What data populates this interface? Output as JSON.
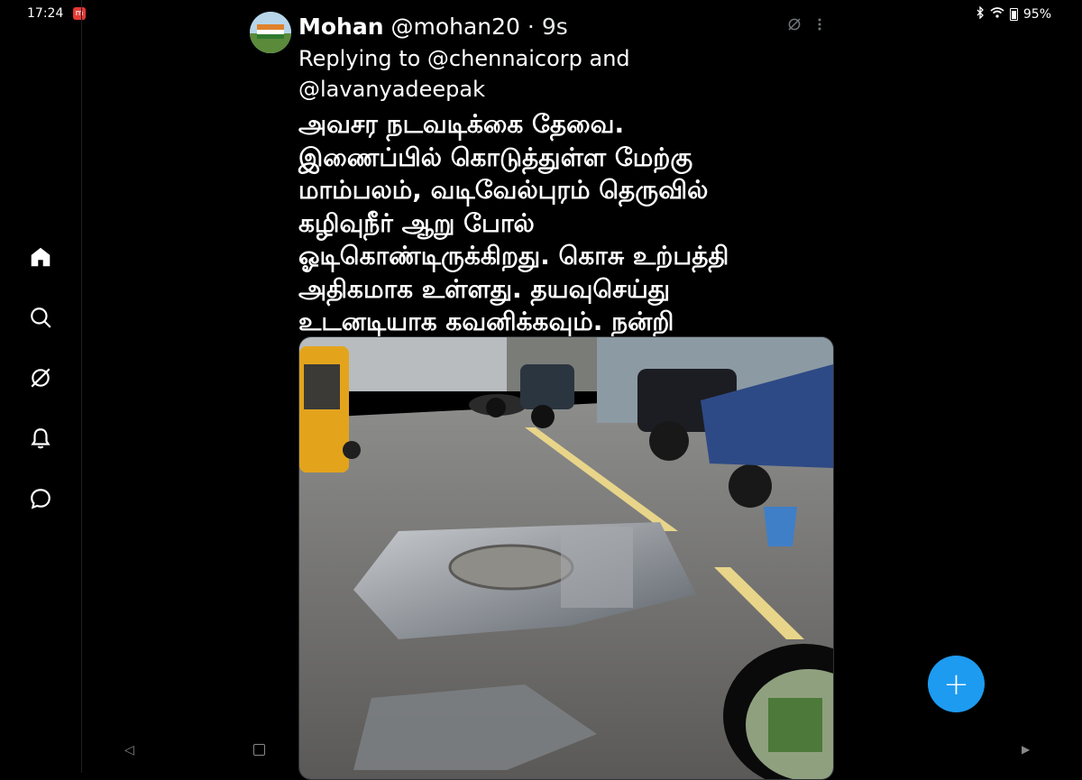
{
  "status_bar": {
    "time": "17:24",
    "battery": "95%"
  },
  "nav_rail": {
    "items": [
      "home-icon",
      "search-icon",
      "grok-icon",
      "notifications-icon",
      "messages-icon"
    ]
  },
  "tweet": {
    "display_name": "Mohan",
    "handle": "@mohan20",
    "separator": "·",
    "time": "9s",
    "replying_to": "Replying to @chennaicorp and @lavanyadeepak",
    "text_lines": [
      "அவசர நடவடிக்கை தேவை.",
      "இணைப்பில் கொடுத்துள்ள மேற்கு",
      "மாம்பலம், வடிவேல்புரம் தெருவில்",
      "கழிவுநீர் ஆறு போல்",
      "ஓடிகொண்டிருக்கிறது. கொசு உற்பத்தி",
      "அதிகமாக உள்ளது. தயவுசெய்து",
      "உடனடியாக கவனிக்கவும். நன்றி"
    ]
  },
  "fab": {
    "label": "+"
  },
  "colors": {
    "background": "#000000",
    "accent": "#1d9bf0",
    "text": "#ffffff"
  }
}
